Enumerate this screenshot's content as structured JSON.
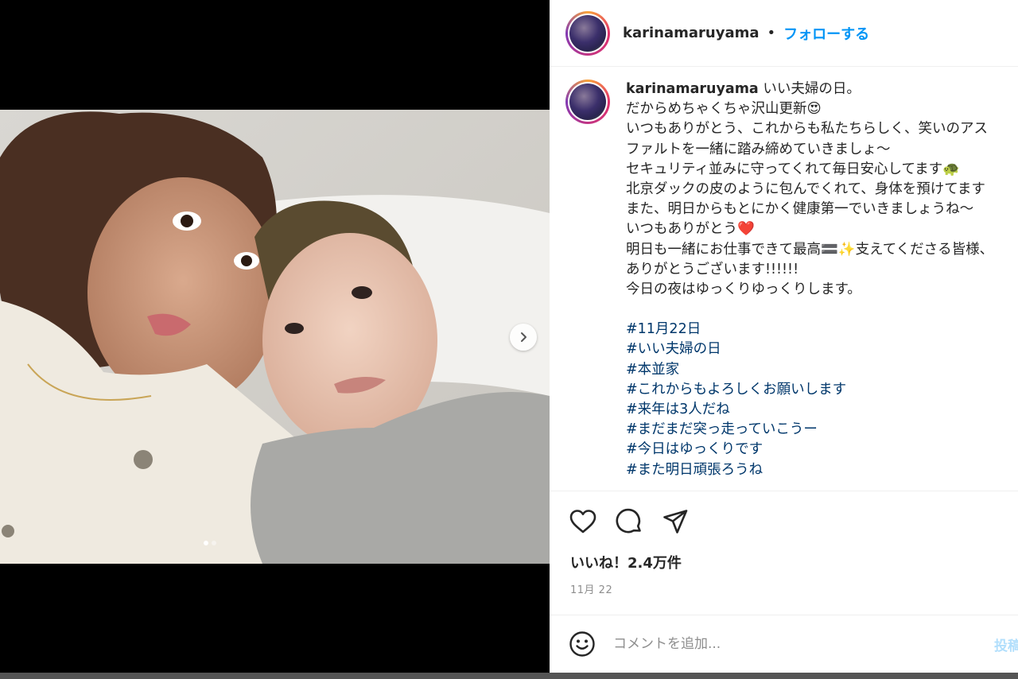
{
  "post": {
    "username": "karinamaruyama",
    "separator": "•",
    "follow_label": "フォローする",
    "caption_first": "いい夫婦の日。",
    "caption_lines": [
      "だからめちゃくちゃ沢山更新😍",
      "いつもありがとう、これからも私たちらしく、笑いのアス",
      "ファルトを一緒に踏み締めていきましょ〜",
      "セキュリティ並みに守ってくれて毎日安心してます🐢",
      "北京ダックの皮のように包んでくれて、身体を預けてます",
      "また、明日からもとにかく健康第一でいきましょうね〜",
      "いつもありがとう❤️",
      "明日も一緒にお仕事できて最高🟰✨支えてくださる皆様、",
      "ありがとうございます!!!!!!",
      "今日の夜はゆっくりゆっくりします。"
    ],
    "hashtags": [
      "#11月22日",
      "#いい夫婦の日",
      "#本並家",
      "#これからもよろしくお願いします",
      "#来年は3人だね",
      "#まだまだ突っ走っていこうー",
      "#今日はゆっくりです",
      "#また明日頑張ろうね"
    ],
    "likes": "いいね！2.4万件",
    "date": "11月 22"
  },
  "comment": {
    "placeholder": "コメントを追加...",
    "post_label": "投稿する"
  },
  "carousel": {
    "total": 2,
    "current": 1
  },
  "icons": {
    "like": "heart-icon",
    "comment": "comment-icon",
    "share": "share-icon",
    "emoji": "smiley-icon",
    "next": "chevron-right-icon"
  },
  "colors": {
    "accent": "#0095f6",
    "hashtag": "#00376b",
    "muted": "#8e8e8e"
  }
}
